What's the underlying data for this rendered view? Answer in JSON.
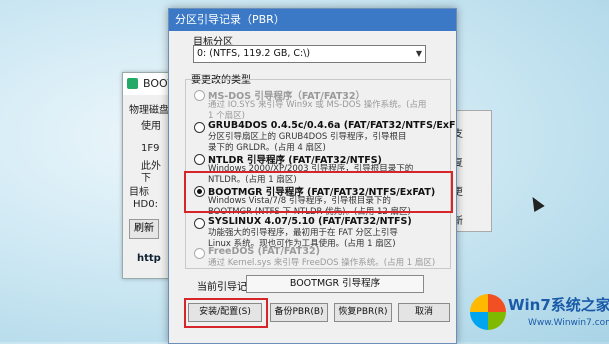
{
  "bg_window": {
    "title": "BOOT",
    "section": "物理磁盘",
    "use_label": "使用",
    "lines": [
      "1F9",
      "此外",
      "下"
    ],
    "target_label": "目标",
    "drive_text": "HD0:",
    "refresh_button": "刷新",
    "url": "http"
  },
  "bg_right": {
    "lines": [
      "支",
      "复",
      "更",
      "新"
    ]
  },
  "dialog": {
    "title": "分区引导记录（PBR）",
    "target_partition_label": "目标分区",
    "target_partition_value": "0: (NTFS, 119.2 GB, C:\\)",
    "type_label": "要更改的类型",
    "options": [
      {
        "title": "MS-DOS 引导程序（FAT/FAT32）",
        "desc1": "通过 IO.SYS 来引导 Win9x 或 MS-DOS 操作系统。(占用",
        "desc2": "1 个扇区)",
        "enabled": false,
        "selected": false
      },
      {
        "title": "GRUB4DOS 0.4.5c/0.4.6a (FAT/FAT32/NTFS/ExF",
        "desc1": "分区引导扇区上的 GRUB4DOS 引导程序，引导根目",
        "desc2": "录下的 GRLDR。(占用 4 扇区)",
        "enabled": true,
        "selected": false
      },
      {
        "title": "NTLDR 引导程序 (FAT/FAT32/NTFS)",
        "desc1": "Windows 2000/XP/2003 引导程序，引导根目录下的",
        "desc2": "NTLDR。(占用 1 扇区)",
        "enabled": true,
        "selected": false
      },
      {
        "title": "BOOTMGR 引导程序 (FAT/FAT32/NTFS/ExFAT)",
        "desc1": "Windows Vista/7/8 引导程序，引导根目录下的",
        "desc2": "BOOTMGR (NTFS 下 NTLDR 优先)。(占用 12 扇区)",
        "enabled": true,
        "selected": true
      },
      {
        "title": "SYSLINUX 4.07/5.10 (FAT/FAT32/NTFS)",
        "desc1": "功能强大的引导程序，最初用于在 FAT 分区上引导",
        "desc2": "Linux 系统。现也可作为工具使用。(占用 1 扇区)",
        "enabled": true,
        "selected": false
      },
      {
        "title": "FreeDOS (FAT/FAT32)",
        "desc1": "通过 Kernel.sys 来引导 FreeDOS 操作系统。(占用 1 扇区)",
        "desc2": "",
        "enabled": false,
        "selected": false
      }
    ],
    "current_boot_label": "当前引导记录：",
    "current_boot_value": "BOOTMGR 引导程序",
    "buttons": {
      "install": "安装/配置(S)",
      "backup": "备份PBR(B)",
      "restore": "恢复PBR(R)",
      "cancel": "取消"
    }
  },
  "watermark": {
    "main": "Win7系统之家",
    "url": "Www.Winwin7.com"
  }
}
